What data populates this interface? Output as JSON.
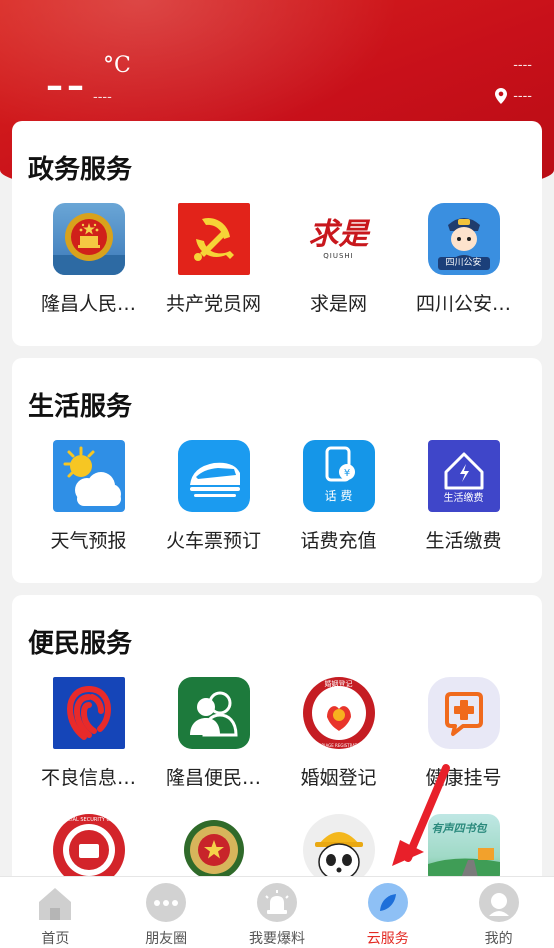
{
  "weather": {
    "temperature": "––",
    "unit": "°C",
    "condition": "----",
    "right_top": "----",
    "location": "----"
  },
  "sections": [
    {
      "title": "政务服务",
      "items": [
        {
          "label": "隆昌人民…",
          "icon": "national-emblem-icon"
        },
        {
          "label": "共产党员网",
          "icon": "party-flag-icon"
        },
        {
          "label": "求是网",
          "icon": "qiushi-logo-icon"
        },
        {
          "label": "四川公安…",
          "icon": "police-officer-icon"
        }
      ]
    },
    {
      "title": "生活服务",
      "items": [
        {
          "label": "天气预报",
          "icon": "weather-sun-cloud-icon"
        },
        {
          "label": "火车票预订",
          "icon": "train-icon"
        },
        {
          "label": "话费充值",
          "icon": "phone-recharge-icon"
        },
        {
          "label": "生活缴费",
          "icon": "utility-payment-icon"
        }
      ]
    },
    {
      "title": "便民服务",
      "items": [
        {
          "label": "不良信息…",
          "icon": "fingerprint-icon"
        },
        {
          "label": "隆昌便民…",
          "icon": "people-icon"
        },
        {
          "label": "婚姻登记",
          "icon": "marriage-registration-icon"
        },
        {
          "label": "健康挂号",
          "icon": "health-register-icon"
        },
        {
          "label": "",
          "icon": "social-security-card-icon"
        },
        {
          "label": "",
          "icon": "emblem-badge-icon"
        },
        {
          "label": "",
          "icon": "panda-helmet-icon"
        },
        {
          "label": "",
          "icon": "road-illustration-icon"
        }
      ],
      "partial_text": {
        "social_card": "SOCIAL SECURITY CARD",
        "road_banner": "有声四书包"
      },
      "icon_text": {
        "police": "四川公安",
        "phone": "话 费",
        "utility": "生活缴费",
        "qiushi_en": "QIUSHI",
        "qiushi_cn": "求是",
        "marriage_top": "婚姻登记",
        "marriage_en": "MARRIAGE REGISTRATION"
      }
    }
  ],
  "tabs": [
    {
      "label": "首页",
      "icon": "home-icon",
      "active": false
    },
    {
      "label": "朋友圈",
      "icon": "chat-bubble-icon",
      "active": false
    },
    {
      "label": "我要爆料",
      "icon": "alarm-light-icon",
      "active": false
    },
    {
      "label": "云服务",
      "icon": "compass-leaf-icon",
      "active": true
    },
    {
      "label": "我的",
      "icon": "user-icon",
      "active": false
    }
  ],
  "colors": {
    "brand_red": "#d21c1a",
    "active_tab": "#e32b24",
    "arrow": "#e8202a"
  }
}
